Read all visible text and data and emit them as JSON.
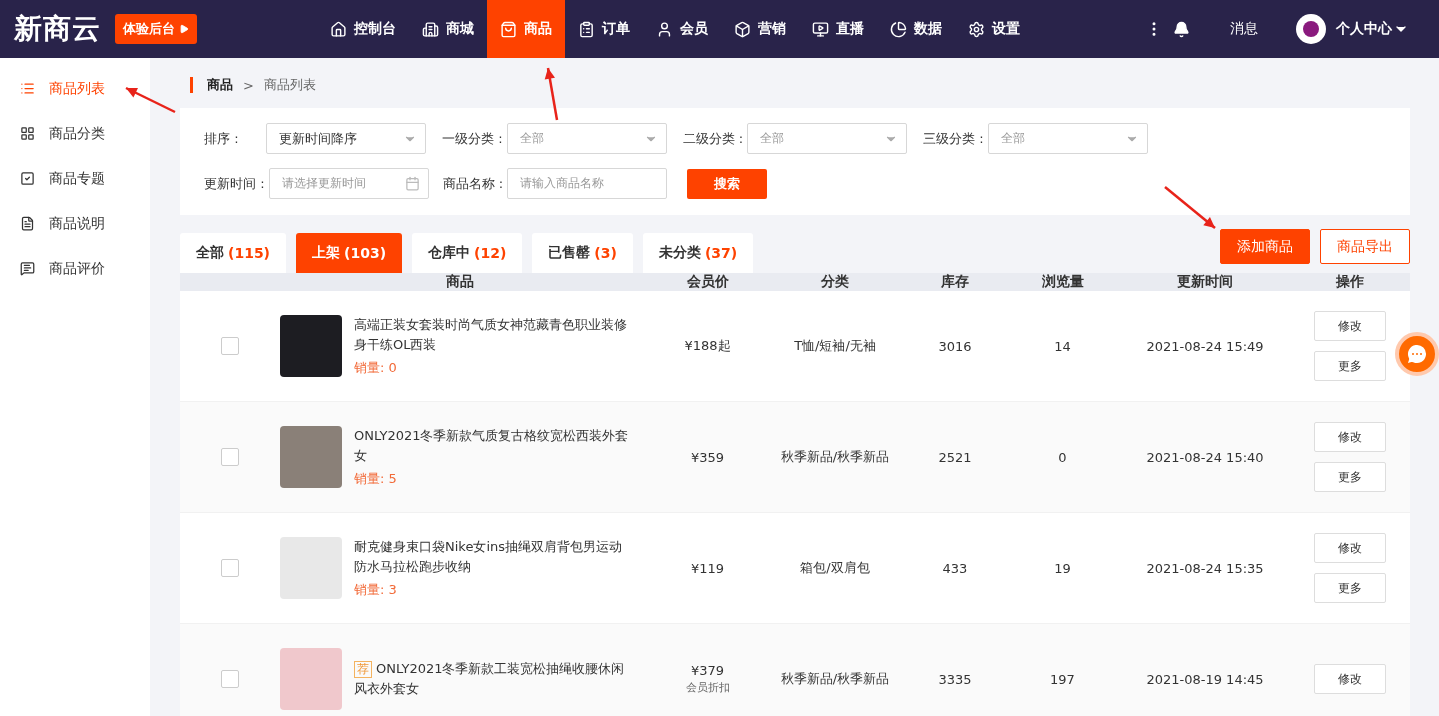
{
  "header": {
    "logo": "新商云",
    "trial_button": "体验后台",
    "nav": [
      {
        "label": "控制台",
        "selected": false
      },
      {
        "label": "商城",
        "selected": false
      },
      {
        "label": "商品",
        "selected": true
      },
      {
        "label": "订单",
        "selected": false
      },
      {
        "label": "会员",
        "selected": false
      },
      {
        "label": "营销",
        "selected": false
      },
      {
        "label": "直播",
        "selected": false
      },
      {
        "label": "数据",
        "selected": false
      },
      {
        "label": "设置",
        "selected": false
      }
    ],
    "messages": "消息",
    "user": "个人中心"
  },
  "sidebar": {
    "items": [
      {
        "label": "商品列表",
        "selected": true
      },
      {
        "label": "商品分类",
        "selected": false
      },
      {
        "label": "商品专题",
        "selected": false
      },
      {
        "label": "商品说明",
        "selected": false
      },
      {
        "label": "商品评价",
        "selected": false
      }
    ]
  },
  "breadcrumb": [
    "商品",
    ">",
    "商品列表"
  ],
  "filters": [
    {
      "label": "排序 :",
      "kind": "select",
      "value": "更新时间降序"
    },
    {
      "label": "一级分类 :",
      "kind": "select",
      "placeholder": "全部"
    },
    {
      "label": "二级分类 :",
      "kind": "select",
      "placeholder": "全部"
    },
    {
      "label": "三级分类 :",
      "kind": "select",
      "placeholder": "全部"
    },
    {
      "label": "更新时间 :",
      "kind": "date",
      "placeholder": "请选择更新时间"
    },
    {
      "label": "商品名称 :",
      "kind": "text",
      "placeholder": "请输入商品名称"
    }
  ],
  "search_button": "搜索",
  "tabs": [
    {
      "label": "全部",
      "count": "(115)",
      "selected": false
    },
    {
      "label": "上架",
      "count": "(103)",
      "selected": true
    },
    {
      "label": "仓库中",
      "count": "(12)",
      "selected": false
    },
    {
      "label": "已售罄",
      "count": "(3)",
      "selected": false
    },
    {
      "label": "未分类",
      "count": "(37)",
      "selected": false
    }
  ],
  "actions": [
    {
      "label": "添加商品",
      "kind": "primary"
    },
    {
      "label": "商品导出",
      "kind": "outline"
    }
  ],
  "table": {
    "columns": [
      "商品",
      "会员价",
      "分类",
      "库存",
      "浏览量",
      "更新时间",
      "操作"
    ],
    "rows": [
      {
        "checked": false,
        "name": "高端正装女套装时尚气质女神范藏青色职业装修身干练OL西装",
        "sales": "销量: 0",
        "price": "¥188起",
        "category": "T恤/短袖/无袖",
        "stock": "3016",
        "views": "14",
        "updated": "2021-08-24 15:49",
        "actions": [
          "修改",
          "更多"
        ]
      },
      {
        "checked": false,
        "name": "ONLY2021冬季新款气质复古格纹宽松西装外套女",
        "sales": "销量: 5",
        "price": "¥359",
        "category": "秋季新品/秋季新品",
        "stock": "2521",
        "views": "0",
        "updated": "2021-08-24 15:40",
        "actions": [
          "修改",
          "更多"
        ]
      },
      {
        "checked": false,
        "name": "耐克健身束口袋Nike女ins抽绳双肩背包男运动防水马拉松跑步收纳",
        "sales": "销量: 3",
        "price": "¥119",
        "category": "箱包/双肩包",
        "stock": "433",
        "views": "19",
        "updated": "2021-08-24 15:35",
        "actions": [
          "修改",
          "更多"
        ]
      },
      {
        "checked": false,
        "tag": "荐",
        "name": "ONLY2021冬季新款工装宽松抽绳收腰休闲风衣外套女",
        "price": "¥379",
        "price_note": "会员折扣",
        "category": "秋季新品/秋季新品",
        "stock": "3335",
        "views": "197",
        "updated": "2021-08-19 14:45",
        "actions": [
          "修改"
        ]
      }
    ]
  }
}
